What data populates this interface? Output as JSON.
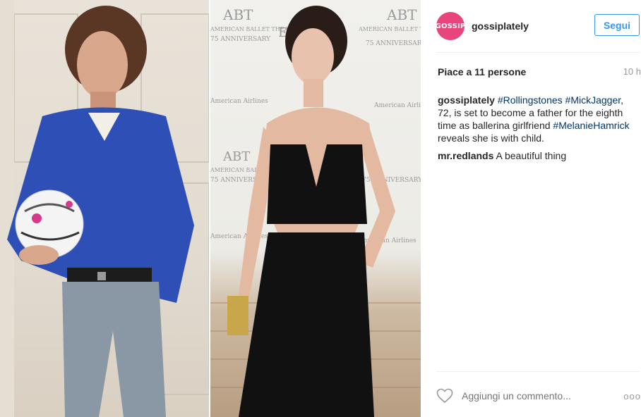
{
  "post": {
    "image_alt": "",
    "wall_text_left": [
      "ABT",
      "AMERICAN BALLET THEATRE",
      "75 ANNIVERSARY"
    ],
    "wall_text_right": [
      "ABT",
      "AMERICAN BALLET THEATRE",
      "75 ANNIVERSARY",
      "American Airlines",
      "E"
    ]
  },
  "header": {
    "avatar_text": "GOSSIP",
    "username": "gossiplately",
    "follow_label": "Segui"
  },
  "meta": {
    "likes": "Piace a 11 persone",
    "time": "10 h"
  },
  "caption": {
    "user": "gossiplately",
    "tag1": "#Rollingstones",
    "tag2": "#MickJagger",
    "text1": ", 72, is set to become a father for the eighth time as ballerina girlfriend",
    "tag3": "#MelanieHamrick",
    "text2": "reveals she is with child."
  },
  "comment": {
    "user": "mr.redlands",
    "text": "A beautiful thing"
  },
  "footer": {
    "comment_placeholder": "Aggiungi un commento...",
    "more_label": "ooo"
  },
  "icons": {
    "heart": "heart-icon",
    "more": "more-options-icon"
  }
}
